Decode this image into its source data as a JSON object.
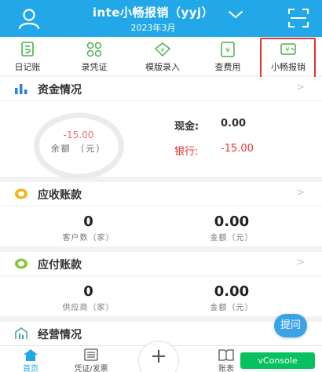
{
  "header": {
    "title": "inte小畅报销（yyj）",
    "period": "2023年3月",
    "user_icon": "user-icon",
    "dropdown_icon": "chevron-down-icon",
    "scan_icon": "scan-icon"
  },
  "toolbar": {
    "items": [
      {
        "label": "日记账",
        "icon": "journal-icon"
      },
      {
        "label": "录凭证",
        "icon": "voucher-entry-icon"
      },
      {
        "label": "模版录入",
        "icon": "template-entry-icon"
      },
      {
        "label": "查费用",
        "icon": "expense-query-icon"
      },
      {
        "label": "小畅报销",
        "icon": "reimbursement-icon"
      }
    ]
  },
  "funds": {
    "title": "资金情况",
    "balance_value": "-15.00",
    "balance_label": "余额 （元）",
    "cash_label": "现金:",
    "cash_value": "0.00",
    "bank_label": "银行:",
    "bank_value": "-15.00"
  },
  "receivable": {
    "title": "应收账款",
    "count": "0",
    "count_label": "客户数（家）",
    "amount": "0.00",
    "amount_label": "金额（元）"
  },
  "payable": {
    "title": "应付账款",
    "count": "0",
    "count_label": "供应商（家）",
    "amount": "0.00",
    "amount_label": "金额（元）"
  },
  "operations": {
    "title": "经营情况"
  },
  "ask_button": "提问",
  "bottom_nav": {
    "items": [
      {
        "label": "首页",
        "icon": "home-icon"
      },
      {
        "label": "凭证/发票",
        "icon": "voucher-invoice-icon"
      },
      {
        "label": "账表",
        "icon": "report-book-icon"
      }
    ],
    "plus": "+"
  },
  "vconsole": "vConsole",
  "colors": {
    "brand": "#22a7e9",
    "negative": "#e8322f",
    "highlight_box": "#e8322f",
    "vconsole": "#07c160"
  }
}
